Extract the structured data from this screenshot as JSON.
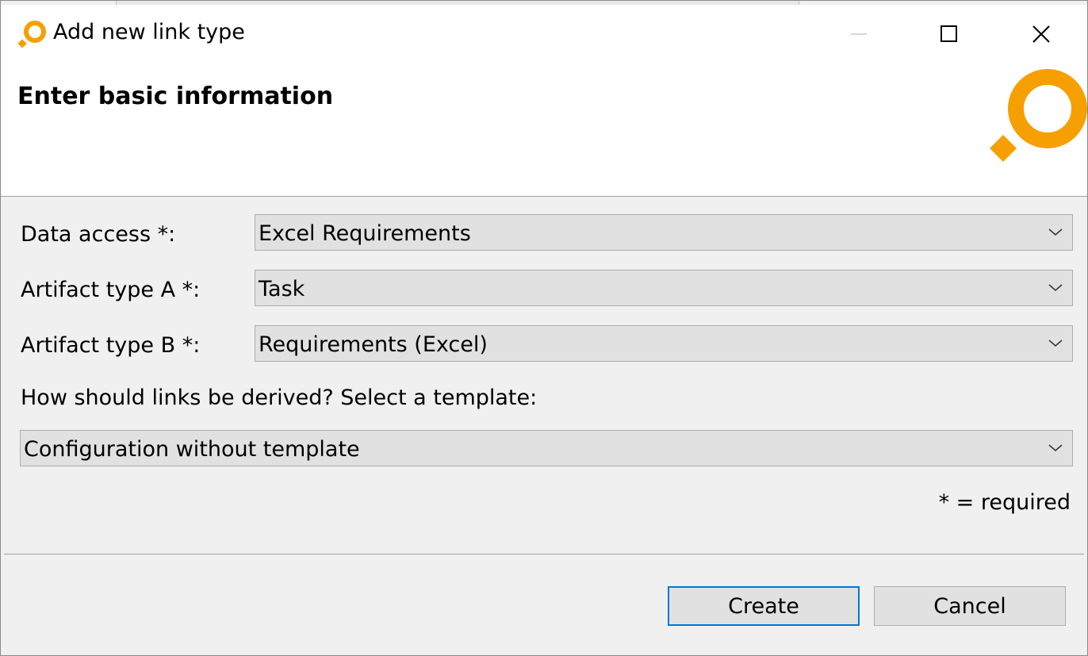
{
  "window": {
    "title": "Add new link type"
  },
  "header": {
    "title": "Enter basic information",
    "accent_color": "#f5a000"
  },
  "form": {
    "data_access": {
      "label": "Data access *:",
      "value": "Excel Requirements"
    },
    "artifact_a": {
      "label": "Artifact type A *:",
      "value": "Task"
    },
    "artifact_b": {
      "label": "Artifact type B *:",
      "value": "Requirements (Excel)"
    },
    "template_prompt": "How should links be derived? Select a template:",
    "template": {
      "value": "Configuration without template"
    },
    "required_note": "* = required"
  },
  "buttons": {
    "create": "Create",
    "cancel": "Cancel"
  },
  "icons": {
    "app": "app-logo-icon",
    "minimize": "minimize-icon",
    "maximize": "maximize-icon",
    "close": "close-icon",
    "dropdown": "chevron-down-icon"
  }
}
